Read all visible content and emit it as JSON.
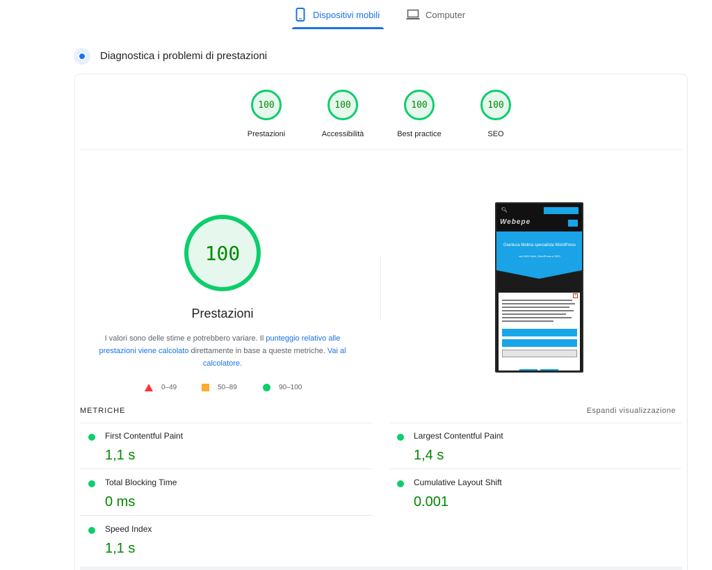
{
  "tabs": [
    {
      "label": "Dispositivi mobili",
      "icon": "smartphone-icon",
      "active": true
    },
    {
      "label": "Computer",
      "icon": "laptop-icon",
      "active": false
    }
  ],
  "section": {
    "title": "Diagnostica i problemi di prestazioni",
    "icon": "diagnostic-icon"
  },
  "scores": [
    {
      "value": "100",
      "label": "Prestazioni"
    },
    {
      "value": "100",
      "label": "Accessibilità"
    },
    {
      "value": "100",
      "label": "Best practice"
    },
    {
      "value": "100",
      "label": "SEO"
    }
  ],
  "main_score": {
    "value": "100",
    "title": "Prestazioni",
    "desc_1": "I valori sono delle stime e potrebbero variare. Il ",
    "link_1": "punteggio relativo alle prestazioni viene calcolato",
    "desc_2": " direttamente in base a queste metriche. ",
    "link_2": "Vai al calcolatore",
    "desc_3": "."
  },
  "legend": [
    {
      "shape": "triangle",
      "label": "0–49",
      "color": "#ff3333"
    },
    {
      "shape": "square",
      "label": "50–89",
      "color": "#ffaa33"
    },
    {
      "shape": "circle",
      "label": "90–100",
      "color": "#0cce6b"
    }
  ],
  "screenshot": {
    "logo": "Webepe",
    "hero_title": "Gianluca Molina specialista WordPress",
    "hero_sub": "dal 2009 Web, WordPress e SEO"
  },
  "metrics": {
    "header": "METRICHE",
    "expand": "Espandi visualizzazione",
    "items": [
      {
        "name": "First Contentful Paint",
        "value": "1,1 s"
      },
      {
        "name": "Largest Contentful Paint",
        "value": "1,4 s"
      },
      {
        "name": "Total Blocking Time",
        "value": "0 ms"
      },
      {
        "name": "Cumulative Layout Shift",
        "value": "0.001"
      },
      {
        "name": "Speed Index",
        "value": "1,1 s"
      }
    ]
  },
  "colors": {
    "accent": "#1a73e8",
    "pass": "#0cce6b",
    "pass_text": "#008800"
  }
}
